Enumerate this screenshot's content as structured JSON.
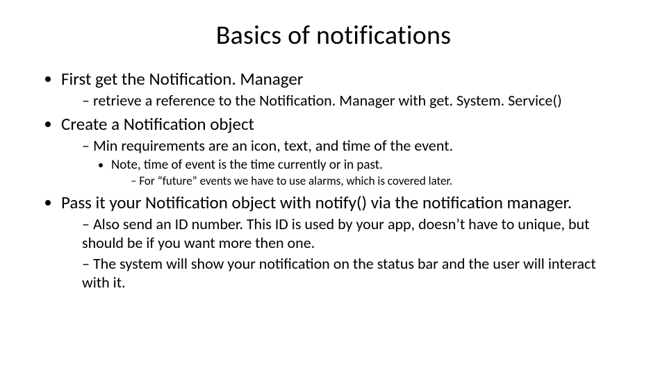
{
  "title": "Basics of notifications",
  "b1": {
    "text": "First get the Notification. Manager",
    "sub1": "retrieve a reference to the Notification. Manager with get. System. Service()"
  },
  "b2": {
    "text": "Create a Notification object",
    "sub1": "Min requirements are an icon, text, and time of the event.",
    "sub1a": "Note, time of event is the time currently or in past.",
    "sub1a1": "For “future” events we have to use alarms, which is covered later."
  },
  "b3": {
    "text": "Pass it your Notification object with notify() via the notification manager.",
    "sub1": "Also send an ID number.  This ID is used by your app, doesn’t have to unique, but should be if you want more then one.",
    "sub2": "The system will show your notification on the status bar and the user will interact with it."
  }
}
